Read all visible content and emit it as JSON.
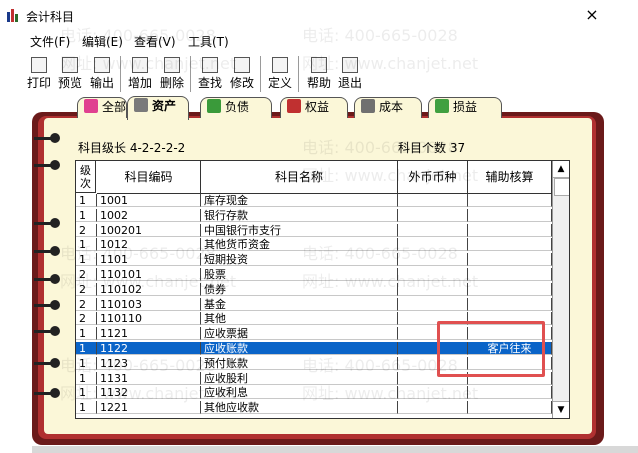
{
  "window": {
    "title": "会计科目",
    "close": "×"
  },
  "menu": [
    {
      "label": "文件(F)"
    },
    {
      "label": "编辑(E)"
    },
    {
      "label": "查看(V)"
    },
    {
      "label": "工具(T)"
    }
  ],
  "toolbar": [
    {
      "label": "打印",
      "icon": "printer-icon"
    },
    {
      "label": "预览",
      "icon": "preview-icon"
    },
    {
      "label": "输出",
      "icon": "export-icon"
    },
    {
      "label": "增加",
      "icon": "add-icon"
    },
    {
      "label": "删除",
      "icon": "delete-icon"
    },
    {
      "label": "查找",
      "icon": "find-icon"
    },
    {
      "label": "修改",
      "icon": "edit-icon"
    },
    {
      "label": "定义",
      "icon": "wand-icon"
    },
    {
      "label": "帮助",
      "icon": "help-icon"
    },
    {
      "label": "退出",
      "icon": "exit-icon"
    }
  ],
  "tabs": [
    {
      "label": "全部",
      "icon_color": "#e04090"
    },
    {
      "label": "资产",
      "icon_color": "#7a7a7a",
      "active": true
    },
    {
      "label": "负债",
      "icon_color": "#3a9a3a"
    },
    {
      "label": "权益",
      "icon_color": "#c03030"
    },
    {
      "label": "成本",
      "icon_color": "#707070"
    },
    {
      "label": "损益",
      "icon_color": "#40a040"
    }
  ],
  "info": {
    "level_label": "科目级长  4-2-2-2-2",
    "count_label": "科目个数  37"
  },
  "table": {
    "columns": [
      "级次",
      "科目编码",
      "科目名称",
      "外币币种",
      "辅助核算"
    ],
    "rows": [
      {
        "level": "1",
        "code": "1001",
        "name": "库存现金",
        "currency": "",
        "aux": ""
      },
      {
        "level": "1",
        "code": "1002",
        "name": "银行存款",
        "currency": "",
        "aux": ""
      },
      {
        "level": "2",
        "code": "100201",
        "name": "  中国银行市支行",
        "currency": "",
        "aux": ""
      },
      {
        "level": "1",
        "code": "1012",
        "name": "其他货币资金",
        "currency": "",
        "aux": ""
      },
      {
        "level": "1",
        "code": "1101",
        "name": "短期投资",
        "currency": "",
        "aux": ""
      },
      {
        "level": "2",
        "code": "110101",
        "name": "  股票",
        "currency": "",
        "aux": ""
      },
      {
        "level": "2",
        "code": "110102",
        "name": "  债券",
        "currency": "",
        "aux": ""
      },
      {
        "level": "2",
        "code": "110103",
        "name": "  基金",
        "currency": "",
        "aux": ""
      },
      {
        "level": "2",
        "code": "110110",
        "name": "  其他",
        "currency": "",
        "aux": ""
      },
      {
        "level": "1",
        "code": "1121",
        "name": "应收票据",
        "currency": "",
        "aux": ""
      },
      {
        "level": "1",
        "code": "1122",
        "name": "应收账款",
        "currency": "",
        "aux": "客户往来",
        "selected": true
      },
      {
        "level": "1",
        "code": "1123",
        "name": "预付账款",
        "currency": "",
        "aux": ""
      },
      {
        "level": "1",
        "code": "1131",
        "name": "应收股利",
        "currency": "",
        "aux": ""
      },
      {
        "level": "1",
        "code": "1132",
        "name": "应收利息",
        "currency": "",
        "aux": ""
      },
      {
        "level": "1",
        "code": "1221",
        "name": "其他应收款",
        "currency": "",
        "aux": ""
      }
    ]
  },
  "scroll": {
    "up": "▲",
    "down": "▼"
  },
  "watermark": {
    "phone": "电话: 400-665-0028",
    "site": "网址: www.chanjet.net"
  },
  "colors": {
    "selected_row": "#0a64c8",
    "highlight_box": "#e05050",
    "book_dark": "#6b1a1a",
    "book_red": "#b03030",
    "page": "#fbf7d8"
  }
}
